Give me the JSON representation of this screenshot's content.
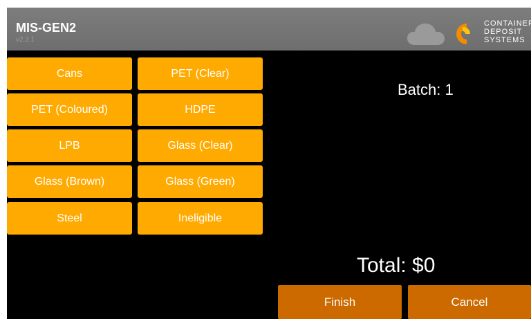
{
  "header": {
    "title": "MIS-GEN2",
    "version": "v2.2.1",
    "status_icon": "cloud-icon",
    "brand_lines": [
      "CONTAINER",
      "DEPOSIT",
      "SYSTEMS"
    ]
  },
  "categories": [
    "Cans",
    "PET (Clear)",
    "PET (Coloured)",
    "HDPE",
    "LPB",
    "Glass (Clear)",
    "Glass (Brown)",
    "Glass (Green)",
    "Steel",
    "Ineligible"
  ],
  "batch": {
    "label": "Batch: 1"
  },
  "total": {
    "label": "Total: $0"
  },
  "actions": {
    "finish_label": "Finish",
    "cancel_label": "Cancel"
  },
  "colors": {
    "category_button": "#ffaa00",
    "action_button": "#cc6a00",
    "header": "#777777",
    "background": "#000000",
    "brand_orange": "#f28c00",
    "brand_yellow": "#ffc20e"
  }
}
